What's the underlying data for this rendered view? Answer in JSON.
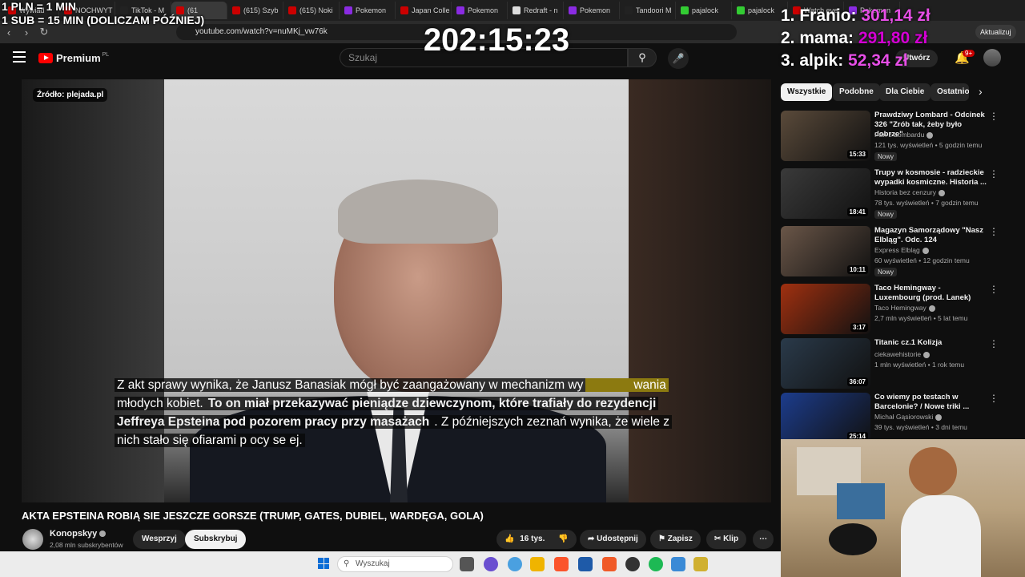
{
  "overlay": {
    "rate_line1": "1 PLN = 1 MIN",
    "rate_line2": "1 SUB = 15 MIN (DOLICZAM PÓŹNIEJ)",
    "timer": "202:15:23",
    "leaderboard": [
      {
        "name": "1. Franio:",
        "amount": "301,14 zł"
      },
      {
        "name": "2. mama:",
        "amount": "291,80 zł"
      },
      {
        "name": "3. alpik:",
        "amount": "52,34 zł"
      }
    ]
  },
  "browser": {
    "tabs": [
      {
        "label": "Wywiad",
        "color": "#c00"
      },
      {
        "label": "NOCHWYT",
        "color": "#c00"
      },
      {
        "label": "TikTok - M",
        "color": "#222"
      },
      {
        "label": "(61",
        "color": "#c00",
        "active": true
      },
      {
        "label": "(615) Szyb",
        "color": "#c00"
      },
      {
        "label": "(615) Noki",
        "color": "#c00"
      },
      {
        "label": "Pokemon",
        "color": "#8a2be2"
      },
      {
        "label": "Japan Colle",
        "color": "#c00"
      },
      {
        "label": "Pokemon",
        "color": "#8a2be2"
      },
      {
        "label": "Redraft - n",
        "color": "#ddd"
      },
      {
        "label": "Pokemon",
        "color": "#8a2be2"
      },
      {
        "label": "Tandoori M",
        "color": "#222"
      },
      {
        "label": "pajalock",
        "color": "#3c3"
      },
      {
        "label": "pajalock",
        "color": "#3c3"
      },
      {
        "label": "Watch eve",
        "color": "#c00"
      },
      {
        "label": "Pokemon",
        "color": "#8a2be2"
      }
    ],
    "url": "youtube.com/watch?v=nuMKj_vw76k",
    "update_label": "Aktualizuj"
  },
  "header": {
    "logo": "Premium",
    "logo_sup": "PL",
    "search_placeholder": "Szukaj",
    "create_label": "Utwórz",
    "notifications": "9+"
  },
  "player": {
    "source_badge": "Źródło: plejada.pl",
    "subtitles": {
      "l1_a": "Z akt sprawy wynika, że Janusz Banasiak mógł być zaangażowany w mechanizm wy",
      "l1_b": "wania",
      "l2_a": "młodych kobiet.",
      "l2_b": "To on miał przekazywać pieniądze dziewczynom, które trafiały do rezydencji",
      "l3_a": "Jeffreya Epsteina pod pozorem pracy przy masażach",
      "l3_b": ". Z późniejszych zeznań wynika, że wiele z",
      "l4": "nich stało się ofiarami p        ocy se         ej."
    }
  },
  "video": {
    "title": "AKTA EPSTEINA ROBIĄ SIE JESZCZE GORSZE (TRUMP, GATES, DUBIEL, WARDĘGA, GOLA)",
    "channel": "Konopskyy",
    "subscribers": "2,08 mln subskrybentów",
    "support_label": "Wesprzyj",
    "subscribe_label": "Subskrybuj",
    "likes": "16 tys.",
    "share_label": "Udostępnij",
    "save_label": "Zapisz",
    "clip_label": "Klip"
  },
  "sidebar": {
    "chips": [
      "Wszystkie",
      "Podobne",
      "Dla Ciebie",
      "Ostatnio"
    ],
    "videos": [
      {
        "title": "Prawdziwy Lombard - Odcinek 326 \"Zrób tak, żeby było dobrze\"",
        "channel": "Pan z Lombardu",
        "meta": "121 tys. wyświetleń • 5 godzin temu",
        "badge": "Nowy",
        "duration": "15:33",
        "thumb": "#5a4a3a"
      },
      {
        "title": "Trupy w kosmosie - radzieckie wypadki kosmiczne. Historia ...",
        "channel": "Historia bez cenzury",
        "meta": "78 tys. wyświetleń • 7 godzin temu",
        "badge": "Nowy",
        "duration": "18:41",
        "thumb": "#3a3a3a"
      },
      {
        "title": "Magazyn Samorządowy \"Nasz Elbląg\". Odc. 124",
        "channel": "Express Elbląg",
        "meta": "60 wyświetleń • 12 godzin temu",
        "badge": "Nowy",
        "duration": "10:11",
        "thumb": "#6a5648"
      },
      {
        "title": "Taco Hemingway - Luxembourg (prod. Lanek)",
        "channel": "Taco Hemingway",
        "meta": "2,7 mln wyświetleń • 5 lat temu",
        "badge": "",
        "duration": "3:17",
        "thumb": "#a03010"
      },
      {
        "title": "Titanic cz.1 Kolizja",
        "channel": "ciekawehistorie",
        "meta": "1 mln wyświetleń • 1 rok temu",
        "badge": "",
        "duration": "36:07",
        "thumb": "#2a3a4a"
      },
      {
        "title": "Co wiemy po testach w Barcelonie? / Nowe triki ...",
        "channel": "Michał Gąsiorowski",
        "meta": "39 tys. wyświetleń • 3 dni temu",
        "badge": "",
        "duration": "25:14",
        "thumb": "#1c3c8c"
      }
    ]
  },
  "taskbar": {
    "search_label": "Wyszukaj"
  }
}
